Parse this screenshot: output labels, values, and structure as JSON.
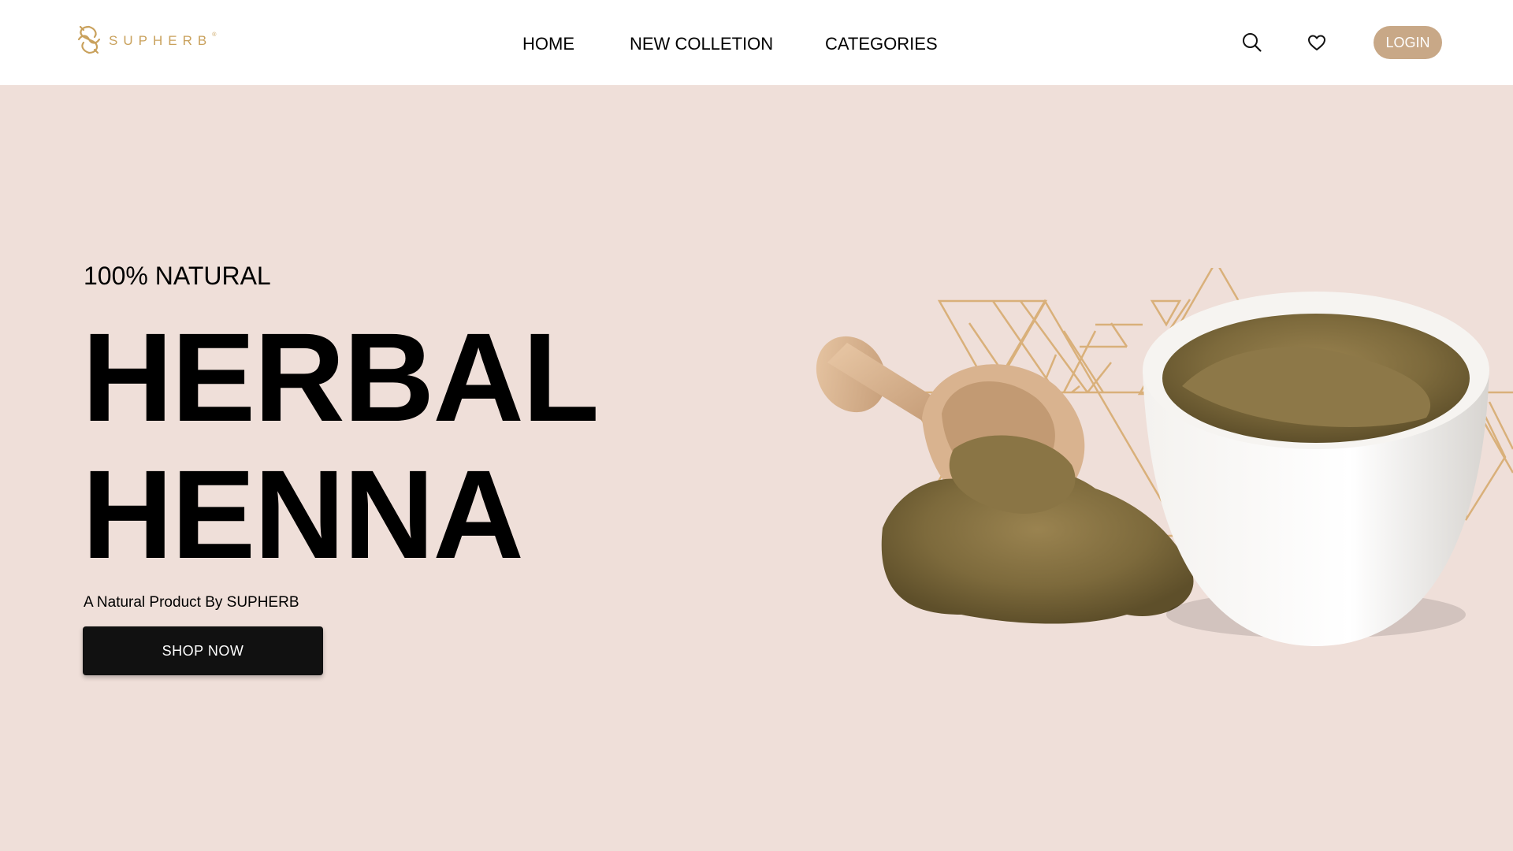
{
  "brand": {
    "name": "SUPHERB",
    "mark": "®",
    "color": "#c9a15c"
  },
  "nav": {
    "home": "HOME",
    "new_collection": "NEW COLLETION",
    "categories": "CATEGORIES"
  },
  "icons": {
    "search": "search-icon",
    "wishlist": "heart-icon"
  },
  "login_label": "LOGIN",
  "hero": {
    "kicker": "100% NATURAL",
    "title_line1": "HERBAL",
    "title_line2": "HENNA",
    "subtitle": "A Natural Product By SUPHERB",
    "cta_label": "SHOP NOW"
  },
  "colors": {
    "background": "#efdfd9",
    "accent": "#c8a887",
    "button_dark": "#111111",
    "line_gold": "#d9b07a"
  }
}
